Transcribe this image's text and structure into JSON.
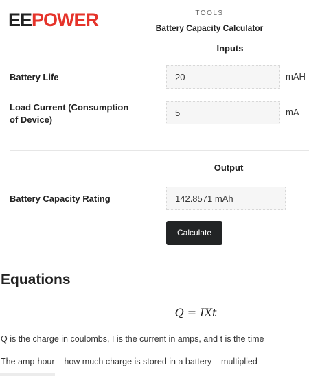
{
  "header": {
    "logo_ee": "EE",
    "logo_power": "POWER",
    "section_label": "TOOLS",
    "title": "Battery Capacity Calculator"
  },
  "inputs": {
    "heading": "Inputs",
    "battery_life": {
      "label": "Battery Life",
      "value": "20",
      "unit": "mAH"
    },
    "load_current": {
      "label_line1": "Load Current (Consumption",
      "label_line2": "of Device)",
      "value": "5",
      "unit": "mA"
    }
  },
  "output": {
    "heading": "Output",
    "capacity": {
      "label": "Battery Capacity Rating",
      "value": "142.8571 mAh"
    }
  },
  "calculate_label": "Calculate",
  "equations": {
    "heading": "Equations",
    "formula": "Q = IXt",
    "para1": "Q is the charge in coulombs, I is the current in amps, and t is the time",
    "para2": "The amp-hour – how much charge is stored in a battery – multiplied"
  },
  "colors": {
    "brand_red": "#e5332a",
    "button_bg": "#222425"
  }
}
